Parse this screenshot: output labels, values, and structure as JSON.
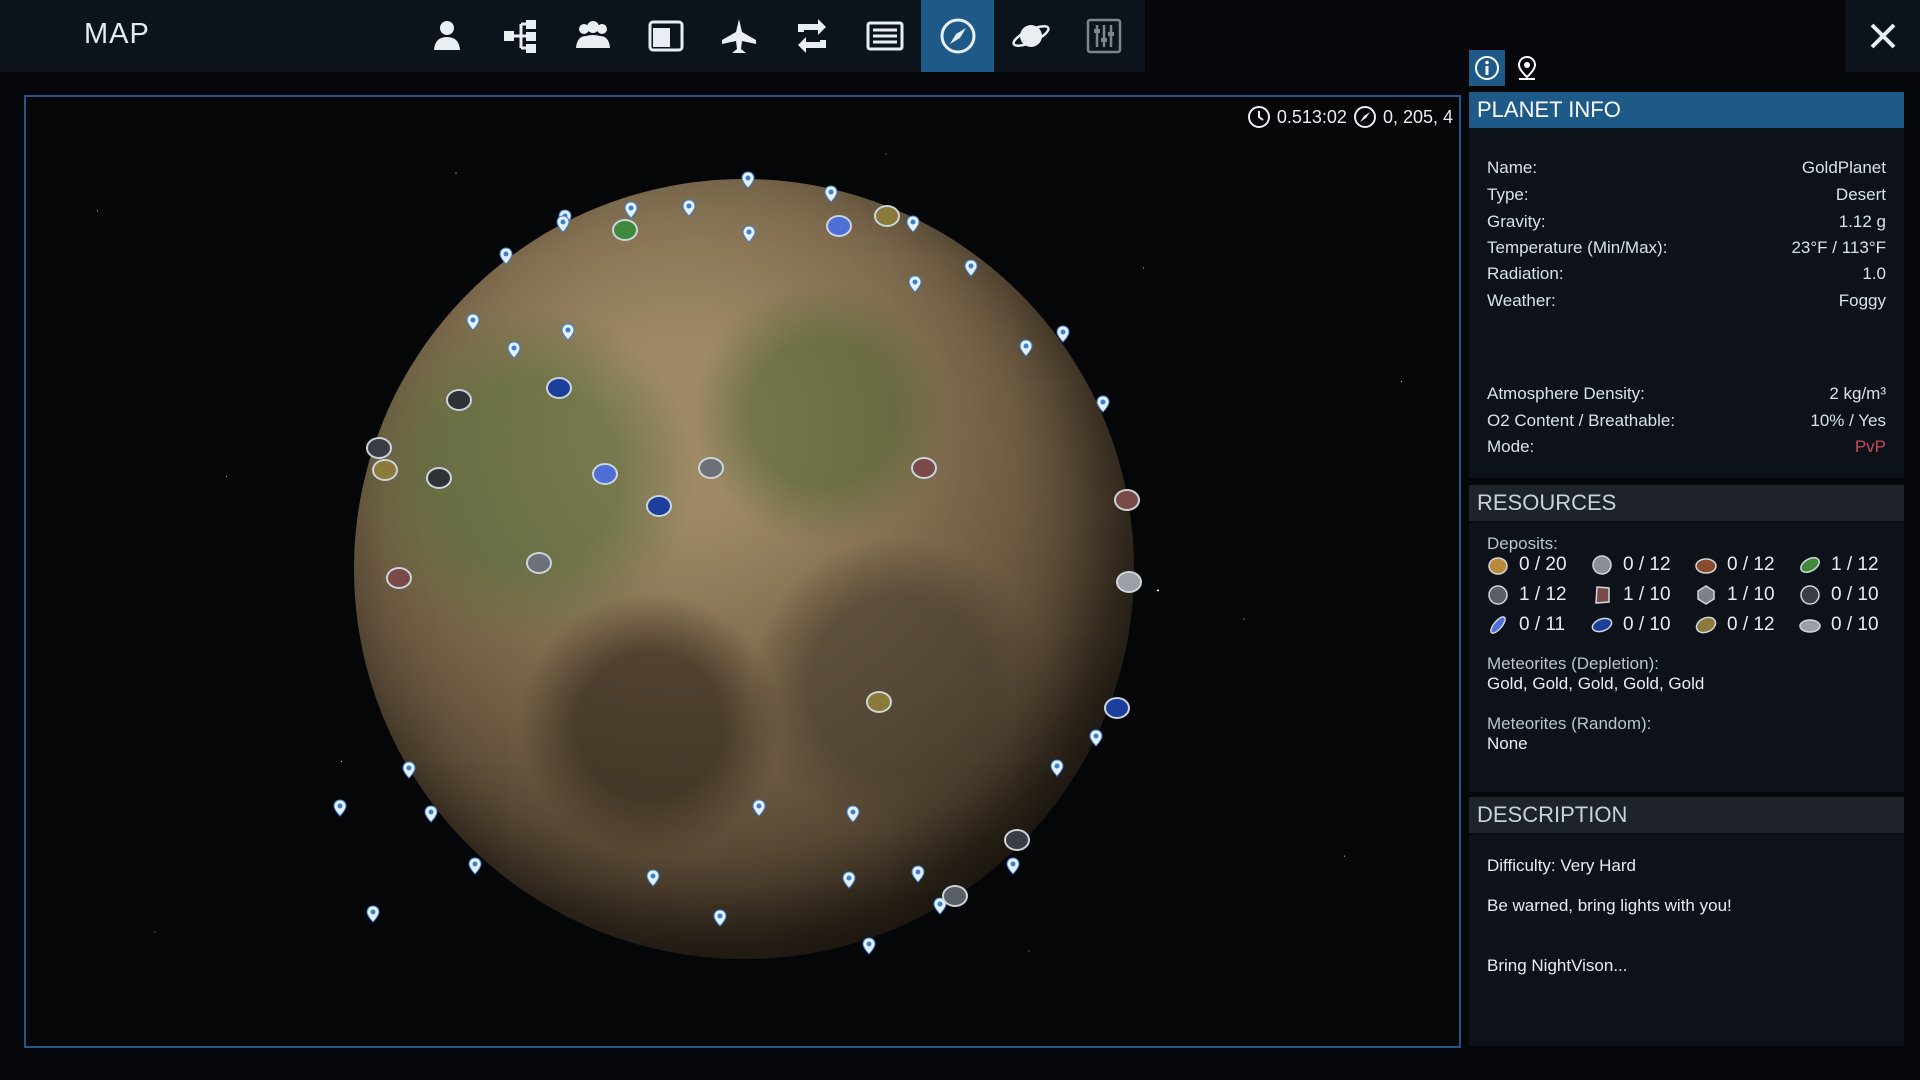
{
  "topbar": {
    "title": "MAP",
    "tabs": [
      {
        "icon": "player-icon"
      },
      {
        "icon": "hierarchy-icon"
      },
      {
        "icon": "faction-icon"
      },
      {
        "icon": "window-icon"
      },
      {
        "icon": "ship-icon"
      },
      {
        "icon": "exchange-icon"
      },
      {
        "icon": "list-icon"
      },
      {
        "icon": "compass-icon",
        "active": true
      },
      {
        "icon": "planet-icon"
      },
      {
        "icon": "sliders-icon"
      }
    ],
    "close_icon": "close-icon"
  },
  "map": {
    "time": "0.513:02",
    "coords": "0, 205, 4"
  },
  "panel_tabs": [
    {
      "icon": "info-icon",
      "active": true
    },
    {
      "icon": "map-pin-icon",
      "active": false
    }
  ],
  "planet_info": {
    "header": "PLANET INFO",
    "rows": [
      {
        "label": "Name:",
        "value": "GoldPlanet"
      },
      {
        "label": "Type:",
        "value": "Desert"
      },
      {
        "label": "Gravity:",
        "value": "1.12 g"
      },
      {
        "label": "Temperature (Min/Max):",
        "value": "23°F / 113°F"
      },
      {
        "label": "Radiation:",
        "value": "1.0"
      },
      {
        "label": "Weather:",
        "value": "Foggy"
      }
    ],
    "rows2": [
      {
        "label": "Atmosphere Density:",
        "value": "2 kg/m³"
      },
      {
        "label": "O2 Content / Breathable:",
        "value": "10% / Yes"
      },
      {
        "label": "Mode:",
        "value": "PvP"
      }
    ]
  },
  "resources": {
    "header": "RESOURCES",
    "deposits_label": "Deposits:",
    "deposits": [
      {
        "icon": "gold-ore-icon",
        "count": "0 / 20",
        "color": "#b88a3a"
      },
      {
        "icon": "iron-ore-icon",
        "count": "0 / 12",
        "color": "#8a8f96"
      },
      {
        "icon": "copper-ore-icon",
        "count": "0 / 12",
        "color": "#8a4a30"
      },
      {
        "icon": "promethium-ore-icon",
        "count": "1 / 12",
        "color": "#3f8a3a"
      },
      {
        "icon": "cobalt-ore-icon",
        "count": "1 / 12",
        "color": "#5a5e66"
      },
      {
        "icon": "magnesium-ore-icon",
        "count": "1 / 10",
        "color": "#7a4a48"
      },
      {
        "icon": "silicon-ore-icon",
        "count": "1 / 10",
        "color": "#7d8088"
      },
      {
        "icon": "neodymium-ore-icon",
        "count": "0 / 10",
        "color": "#3a3d44"
      },
      {
        "icon": "erestrum-ore-icon",
        "count": "0 / 11",
        "color": "#4f6fd6"
      },
      {
        "icon": "zascosium-ore-icon",
        "count": "0 / 10",
        "color": "#1b3f9a"
      },
      {
        "icon": "sathium-ore-icon",
        "count": "0 / 12",
        "color": "#8c7a3a"
      },
      {
        "icon": "pentaxid-ore-icon",
        "count": "0 / 10",
        "color": "#9aa0a6"
      }
    ],
    "meteorites_depletion_label": "Meteorites (Depletion):",
    "meteorites_depletion": "Gold, Gold, Gold, Gold, Gold",
    "meteorites_random_label": "Meteorites (Random):",
    "meteorites_random": "None"
  },
  "description": {
    "header": "DESCRIPTION",
    "difficulty_label": "Difficulty:",
    "difficulty": "Very Hard",
    "line1": "Be warned, bring lights with you!",
    "line2": "Bring NightVison..."
  }
}
